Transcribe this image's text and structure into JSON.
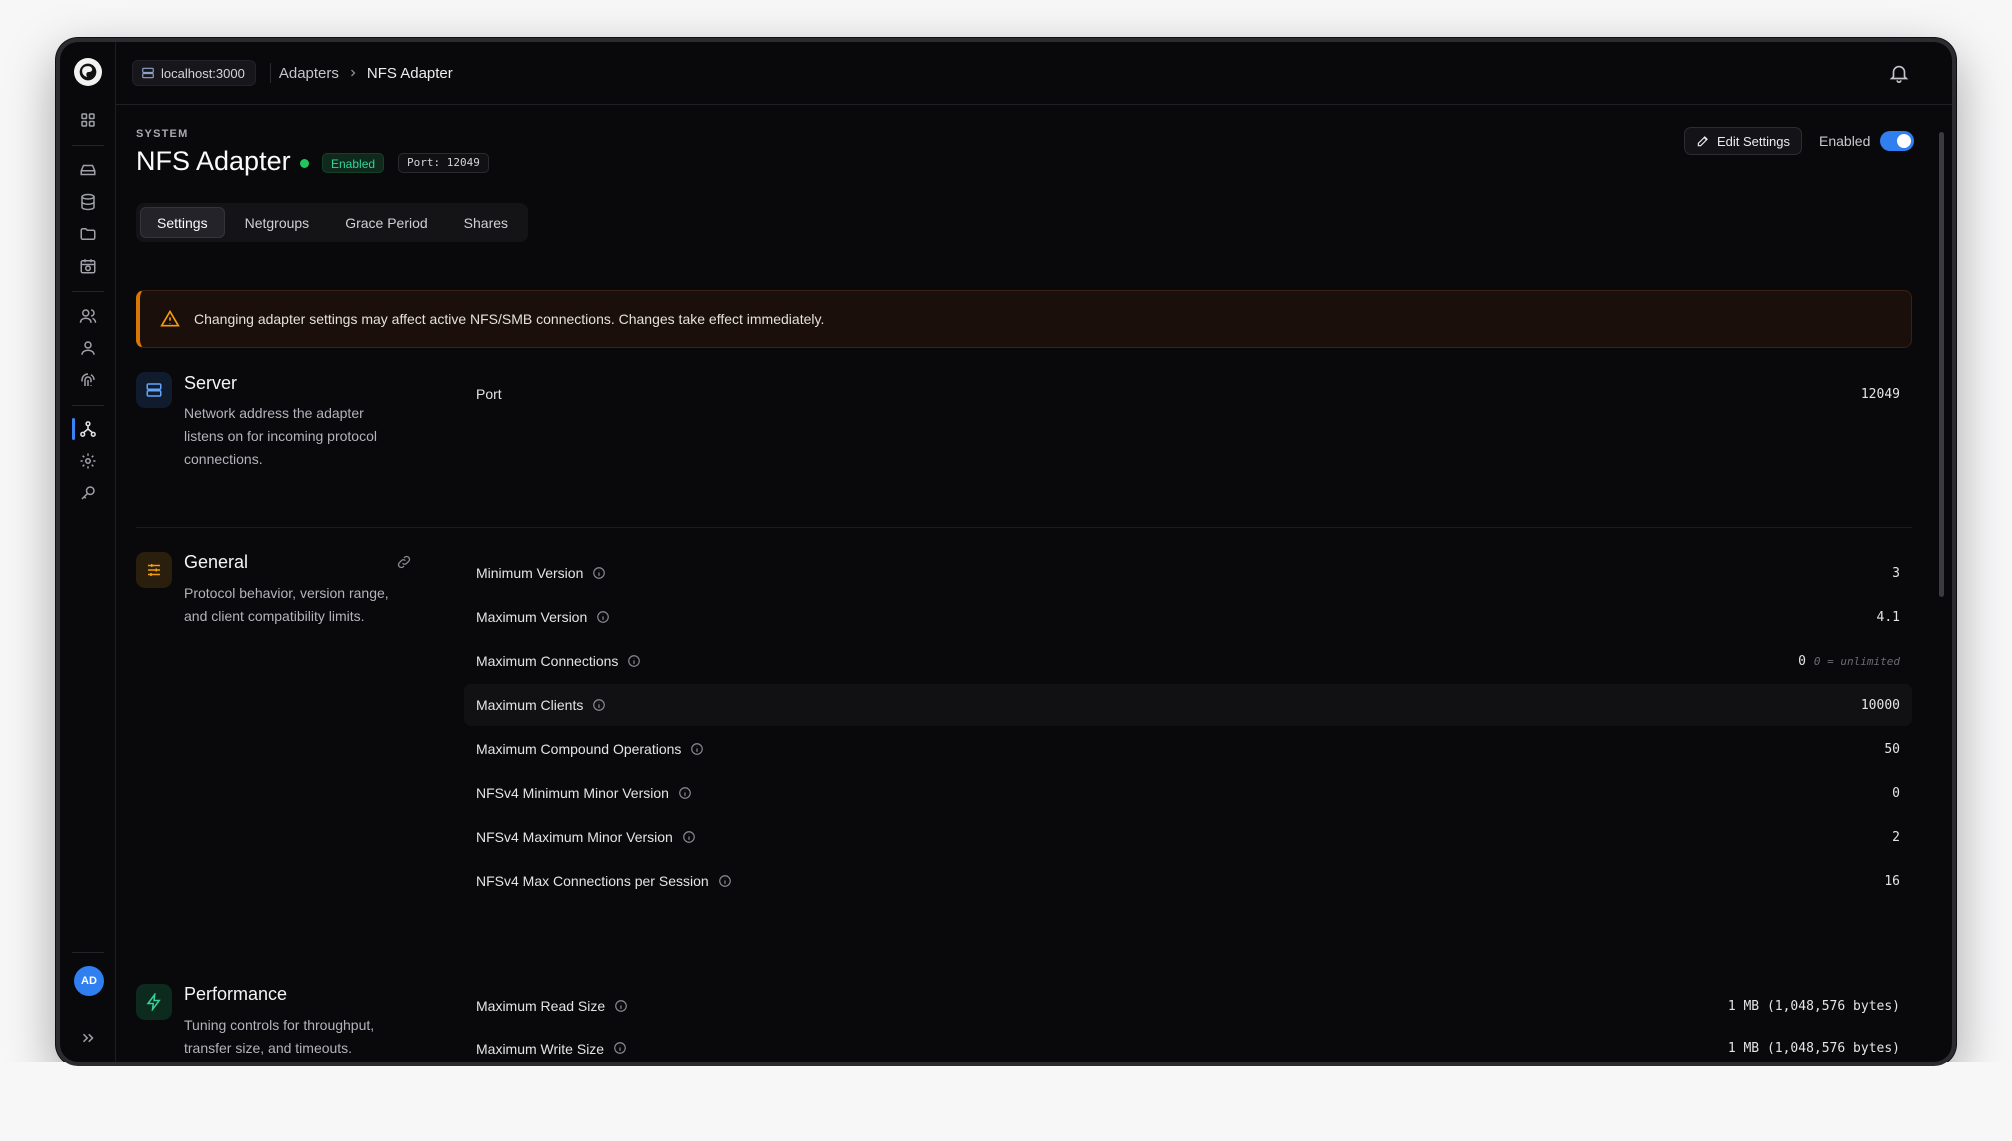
{
  "topbar": {
    "host": "localhost:3000",
    "breadcrumbs": [
      "Adapters",
      "NFS Adapter"
    ]
  },
  "rail": {
    "icons": [
      "dashboard-icon",
      "drive-icon",
      "database-icon",
      "folder-icon",
      "calendar-clock-icon",
      "users-icon",
      "user-group-icon",
      "fingerprint-icon",
      "network-icon",
      "gear-icon",
      "key-icon"
    ],
    "active": "network-icon",
    "avatar_initials": "AD",
    "accent": "#3b82f6"
  },
  "header": {
    "eyebrow": "SYSTEM",
    "title": "NFS Adapter",
    "status_badge": "Enabled",
    "port_badge": "Port: 12049",
    "edit_button": "Edit Settings",
    "toggle_label": "Enabled",
    "toggle_on": true
  },
  "tabs": [
    "Settings",
    "Netgroups",
    "Grace Period",
    "Shares"
  ],
  "active_tab": "Settings",
  "warning": {
    "text": "Changing adapter settings may affect active NFS/SMB connections. Changes take effect immediately.",
    "color": "#d97706"
  },
  "sections": {
    "server": {
      "title": "Server",
      "description": "Network address the adapter listens on for incoming protocol connections.",
      "rows": [
        {
          "label": "Port",
          "value": "12049"
        }
      ]
    },
    "general": {
      "title": "General",
      "description": "Protocol behavior, version range, and client compatibility limits.",
      "rows": [
        {
          "label": "Minimum Version",
          "value": "3"
        },
        {
          "label": "Maximum Version",
          "value": "4.1"
        },
        {
          "label": "Maximum Connections",
          "value": "0",
          "hint": "0 = unlimited"
        },
        {
          "label": "Maximum Clients",
          "value": "10000"
        },
        {
          "label": "Maximum Compound Operations",
          "value": "50"
        },
        {
          "label": "NFSv4 Minimum Minor Version",
          "value": "0"
        },
        {
          "label": "NFSv4 Maximum Minor Version",
          "value": "2"
        },
        {
          "label": "NFSv4 Max Connections per Session",
          "value": "16"
        }
      ]
    },
    "performance": {
      "title": "Performance",
      "description": "Tuning controls for throughput, transfer size, and timeouts.",
      "rows": [
        {
          "label": "Maximum Read Size",
          "value": "1 MB (1,048,576 bytes)"
        },
        {
          "label": "Maximum Write Size",
          "value": "1 MB (1,048,576 bytes)"
        }
      ]
    }
  }
}
